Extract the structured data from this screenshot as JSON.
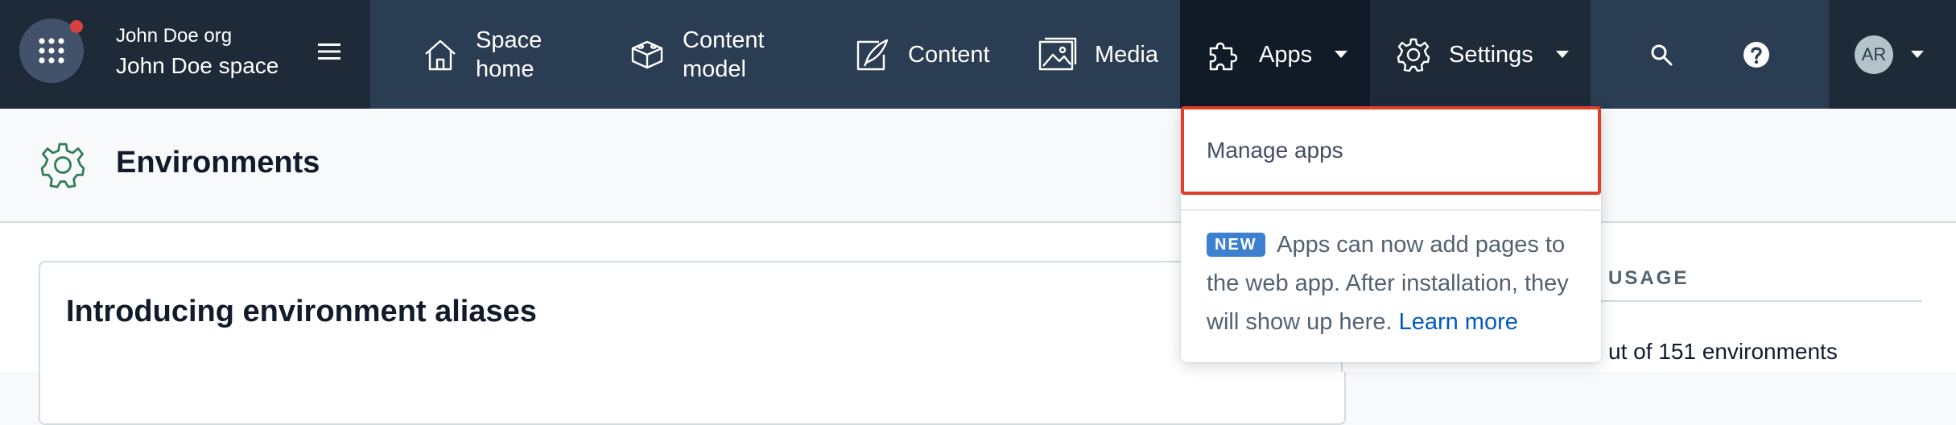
{
  "nav": {
    "org_name": "John Doe org",
    "space_name": "John Doe space",
    "items": [
      {
        "label": "Space\nhome",
        "icon": "home-icon"
      },
      {
        "label": "Content\nmodel",
        "icon": "content-model-icon"
      },
      {
        "label": "Content",
        "icon": "content-icon"
      },
      {
        "label": "Media",
        "icon": "media-icon"
      },
      {
        "label": "Apps",
        "icon": "puzzle-icon"
      },
      {
        "label": "Settings",
        "icon": "gear-icon"
      }
    ],
    "account_initials": "AR"
  },
  "page": {
    "title": "Environments"
  },
  "card": {
    "title": "Introducing environment aliases"
  },
  "side_panel": {
    "usage_heading": "USAGE",
    "usage_text": "ut of 151 environments"
  },
  "dropdown": {
    "manage_apps": "Manage apps",
    "badge": "NEW",
    "message": "Apps can now add pages to the web app. After installation, they will show up here.",
    "link": "Learn more"
  },
  "colors": {
    "nav_bg": "#2b3d52",
    "nav_active_bg": "#111b28",
    "highlight_border": "#e03e2b",
    "badge_bg": "#3c80cf",
    "link": "#0059c8",
    "page_icon": "#2e7d52"
  }
}
